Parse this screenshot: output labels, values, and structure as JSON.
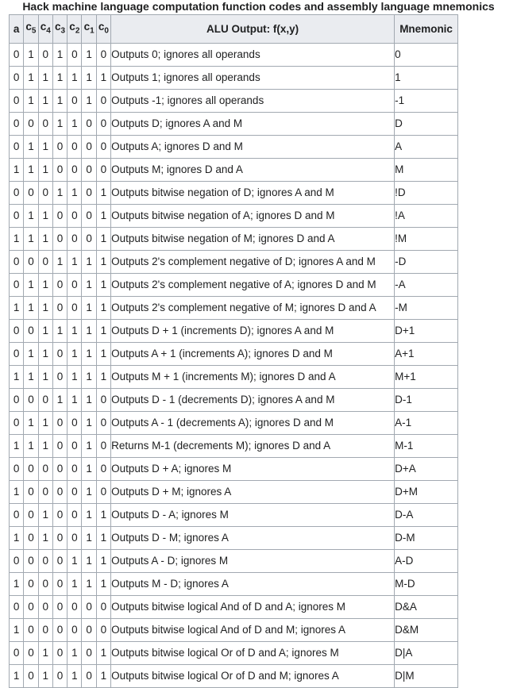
{
  "caption": "Hack machine language computation function codes and assembly language mnemonics",
  "headers": {
    "a": "a",
    "c5": "c5",
    "c4": "c4",
    "c3": "c3",
    "c2": "c2",
    "c1": "c1",
    "c0": "c0",
    "output": "ALU Output: f(x,y)",
    "mnemonic": "Mnemonic"
  },
  "rows": [
    {
      "bits": [
        "0",
        "1",
        "0",
        "1",
        "0",
        "1",
        "0"
      ],
      "output": "Outputs 0; ignores all operands",
      "mnemonic": "0"
    },
    {
      "bits": [
        "0",
        "1",
        "1",
        "1",
        "1",
        "1",
        "1"
      ],
      "output": "Outputs 1; ignores all operands",
      "mnemonic": "1"
    },
    {
      "bits": [
        "0",
        "1",
        "1",
        "1",
        "0",
        "1",
        "0"
      ],
      "output": "Outputs -1; ignores all operands",
      "mnemonic": "-1"
    },
    {
      "bits": [
        "0",
        "0",
        "0",
        "1",
        "1",
        "0",
        "0"
      ],
      "output": "Outputs D; ignores A and M",
      "mnemonic": "D"
    },
    {
      "bits": [
        "0",
        "1",
        "1",
        "0",
        "0",
        "0",
        "0"
      ],
      "output": "Outputs A; ignores D and M",
      "mnemonic": "A"
    },
    {
      "bits": [
        "1",
        "1",
        "1",
        "0",
        "0",
        "0",
        "0"
      ],
      "output": "Outputs M; ignores D and A",
      "mnemonic": "M"
    },
    {
      "bits": [
        "0",
        "0",
        "0",
        "1",
        "1",
        "0",
        "1"
      ],
      "output": "Outputs bitwise negation of D; ignores A and M",
      "mnemonic": "!D"
    },
    {
      "bits": [
        "0",
        "1",
        "1",
        "0",
        "0",
        "0",
        "1"
      ],
      "output": "Outputs bitwise negation of A; ignores D and M",
      "mnemonic": "!A"
    },
    {
      "bits": [
        "1",
        "1",
        "1",
        "0",
        "0",
        "0",
        "1"
      ],
      "output": "Outputs bitwise negation of M; ignores D and A",
      "mnemonic": "!M"
    },
    {
      "bits": [
        "0",
        "0",
        "0",
        "1",
        "1",
        "1",
        "1"
      ],
      "output": "Outputs 2's complement negative of D; ignores A and M",
      "mnemonic": "-D"
    },
    {
      "bits": [
        "0",
        "1",
        "1",
        "0",
        "0",
        "1",
        "1"
      ],
      "output": "Outputs 2's complement negative of A; ignores D and M",
      "mnemonic": "-A"
    },
    {
      "bits": [
        "1",
        "1",
        "1",
        "0",
        "0",
        "1",
        "1"
      ],
      "output": "Outputs 2's complement negative of M; ignores D and A",
      "mnemonic": "-M"
    },
    {
      "bits": [
        "0",
        "0",
        "1",
        "1",
        "1",
        "1",
        "1"
      ],
      "output": "Outputs D + 1 (increments D); ignores A and M",
      "mnemonic": "D+1"
    },
    {
      "bits": [
        "0",
        "1",
        "1",
        "0",
        "1",
        "1",
        "1"
      ],
      "output": "Outputs A + 1 (increments A); ignores D and M",
      "mnemonic": "A+1"
    },
    {
      "bits": [
        "1",
        "1",
        "1",
        "0",
        "1",
        "1",
        "1"
      ],
      "output": "Outputs M + 1 (increments M); ignores D and A",
      "mnemonic": "M+1"
    },
    {
      "bits": [
        "0",
        "0",
        "0",
        "1",
        "1",
        "1",
        "0"
      ],
      "output": "Outputs D - 1 (decrements D); ignores A and M",
      "mnemonic": "D-1"
    },
    {
      "bits": [
        "0",
        "1",
        "1",
        "0",
        "0",
        "1",
        "0"
      ],
      "output": "Outputs A - 1 (decrements A); ignores D and M",
      "mnemonic": "A-1"
    },
    {
      "bits": [
        "1",
        "1",
        "1",
        "0",
        "0",
        "1",
        "0"
      ],
      "output": "Returns M-1 (decrements M); ignores D and A",
      "mnemonic": "M-1"
    },
    {
      "bits": [
        "0",
        "0",
        "0",
        "0",
        "0",
        "1",
        "0"
      ],
      "output": "Outputs D + A; ignores M",
      "mnemonic": "D+A"
    },
    {
      "bits": [
        "1",
        "0",
        "0",
        "0",
        "0",
        "1",
        "0"
      ],
      "output": "Outputs D + M; ignores A",
      "mnemonic": "D+M"
    },
    {
      "bits": [
        "0",
        "0",
        "1",
        "0",
        "0",
        "1",
        "1"
      ],
      "output": "Outputs D - A; ignores M",
      "mnemonic": "D-A"
    },
    {
      "bits": [
        "1",
        "0",
        "1",
        "0",
        "0",
        "1",
        "1"
      ],
      "output": "Outputs D - M; ignores A",
      "mnemonic": "D-M"
    },
    {
      "bits": [
        "0",
        "0",
        "0",
        "0",
        "1",
        "1",
        "1"
      ],
      "output": "Outputs A - D; ignores M",
      "mnemonic": "A-D"
    },
    {
      "bits": [
        "1",
        "0",
        "0",
        "0",
        "1",
        "1",
        "1"
      ],
      "output": "Outputs M - D; ignores A",
      "mnemonic": "M-D"
    },
    {
      "bits": [
        "0",
        "0",
        "0",
        "0",
        "0",
        "0",
        "0"
      ],
      "output": "Outputs bitwise logical And of D and A; ignores M",
      "mnemonic": "D&A"
    },
    {
      "bits": [
        "1",
        "0",
        "0",
        "0",
        "0",
        "0",
        "0"
      ],
      "output": "Outputs bitwise logical And of D and M; ignores A",
      "mnemonic": "D&M"
    },
    {
      "bits": [
        "0",
        "0",
        "1",
        "0",
        "1",
        "0",
        "1"
      ],
      "output": "Outputs bitwise logical Or of D and A; ignores M",
      "mnemonic": "D|A"
    },
    {
      "bits": [
        "1",
        "0",
        "1",
        "0",
        "1",
        "0",
        "1"
      ],
      "output": "Outputs bitwise logical Or of D and M; ignores A",
      "mnemonic": "D|M"
    }
  ]
}
